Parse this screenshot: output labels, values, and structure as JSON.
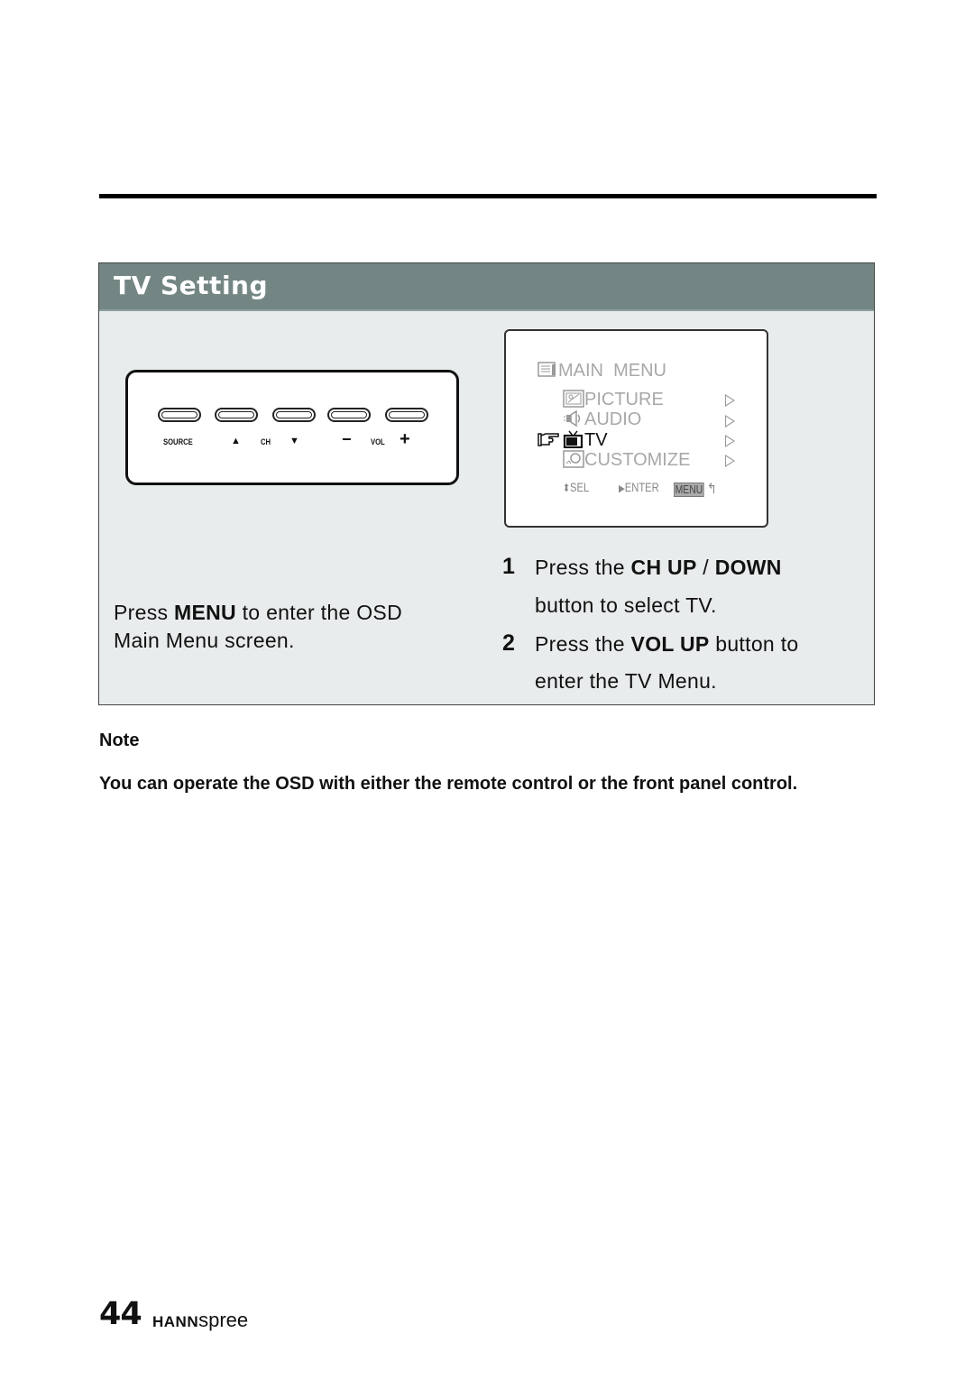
{
  "section": {
    "title": "TV Setting"
  },
  "front_panel": {
    "buttons": [
      "source",
      "ch-up",
      "ch-down",
      "vol-down",
      "vol-up"
    ],
    "labels": {
      "source": "SOURCE",
      "ch": "CH",
      "vol": "VOL",
      "ch_up_symbol": "▲",
      "ch_down_symbol": "▼",
      "vol_down_symbol": "−",
      "vol_up_symbol": "+"
    }
  },
  "osd": {
    "title": "MAIN  MENU",
    "items": [
      {
        "label": "PICTURE",
        "icon": "picture-icon",
        "selected": false
      },
      {
        "label": "AUDIO",
        "icon": "speaker-icon",
        "selected": false
      },
      {
        "label": "TV",
        "icon": "tv-icon",
        "selected": true
      },
      {
        "label": "CUSTOMIZE",
        "icon": "customize-icon",
        "selected": false
      }
    ],
    "footer": {
      "sel": "SEL",
      "enter": "ENTER",
      "menu": "MENU"
    }
  },
  "instructions": {
    "left": {
      "prefix": "Press ",
      "bold": "MENU",
      "suffix": " to enter the OSD",
      "line2": "Main Menu screen."
    },
    "steps": [
      {
        "number": "1",
        "line1_prefix": "Press the ",
        "line1_bold1": "CH UP",
        "line1_mid": " / ",
        "line1_bold2": "DOWN",
        "line2": "button to select TV."
      },
      {
        "number": "2",
        "line1_prefix": "Press the ",
        "line1_bold": "VOL UP",
        "line1_suffix": " button to",
        "line2": "enter the TV Menu."
      }
    ]
  },
  "note": {
    "title": "Note",
    "body": "You can operate the OSD with either the remote control or the front panel control."
  },
  "footer": {
    "page_number": "44",
    "brand_bold": "HANN",
    "brand_light": "spree"
  }
}
